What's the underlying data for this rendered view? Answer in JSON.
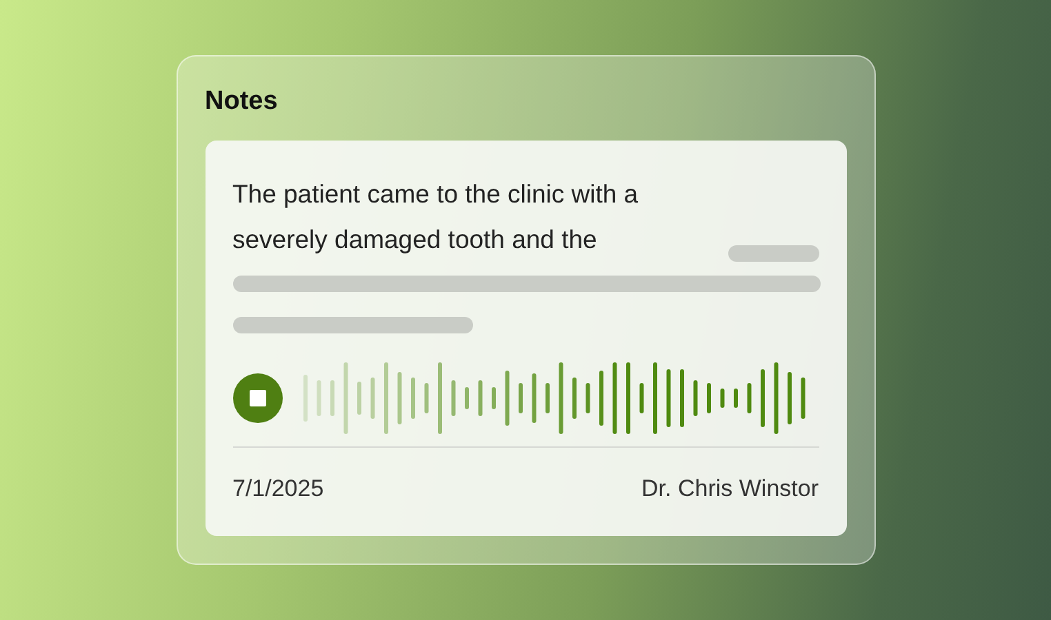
{
  "card": {
    "title": "Notes"
  },
  "note": {
    "text": "The patient came to the clinic with a severely damaged tooth and the",
    "date": "7/1/2025",
    "author": "Dr. Chris Winstor"
  }
}
